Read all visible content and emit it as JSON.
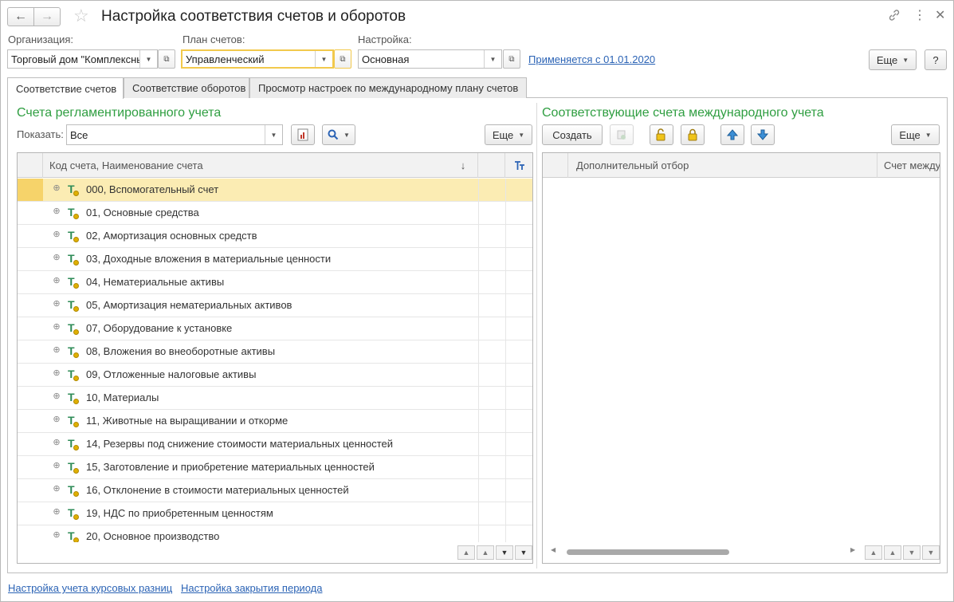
{
  "window": {
    "title": "Настройка соответствия счетов и оборотов"
  },
  "filters": {
    "organization": {
      "label": "Организация:",
      "value": "Торговый дом \"Комплексный\""
    },
    "plan": {
      "label": "План счетов:",
      "value": "Управленческий"
    },
    "setting": {
      "label": "Настройка:",
      "value": "Основная"
    },
    "applies_link": "Применяется с 01.01.2020",
    "more_label": "Еще",
    "help_label": "?"
  },
  "tabs": [
    {
      "label": "Соответствие счетов",
      "active": true
    },
    {
      "label": "Соответствие оборотов",
      "active": false
    },
    {
      "label": "Просмотр настроек по международному плану счетов",
      "active": false
    }
  ],
  "left": {
    "title": "Счета регламентированного учета",
    "show_label": "Показать:",
    "show_value": "Все",
    "more_label": "Еще",
    "column_header": "Код счета, Наименование счета",
    "rows": [
      "000, Вспомогательный счет",
      "01, Основные средства",
      "02, Амортизация основных средств",
      "03, Доходные вложения в материальные ценности",
      "04, Нематериальные активы",
      "05, Амортизация нематериальных активов",
      "07, Оборудование к установке",
      "08, Вложения во внеоборотные активы",
      "09, Отложенные налоговые активы",
      "10, Материалы",
      "11, Животные на выращивании и откорме",
      "14, Резервы под снижение стоимости материальных ценностей",
      "15, Заготовление и приобретение материальных ценностей",
      "16, Отклонение в стоимости материальных ценностей",
      "19, НДС по приобретенным ценностям",
      "20, Основное производство"
    ],
    "selected_row": 0
  },
  "right": {
    "title": "Соответствующие счета международного учета",
    "create_label": "Создать",
    "more_label": "Еще",
    "columns": [
      "Дополнительный отбор",
      "Счет международного учета"
    ]
  },
  "footer": {
    "links": [
      "Настройка учета курсовых разниц",
      "Настройка закрытия периода"
    ]
  },
  "colors": {
    "accent_green": "#2f9e41",
    "link_blue": "#2b63b5",
    "selected_row": "#fbecb3",
    "focus_border": "#f2c94c"
  }
}
